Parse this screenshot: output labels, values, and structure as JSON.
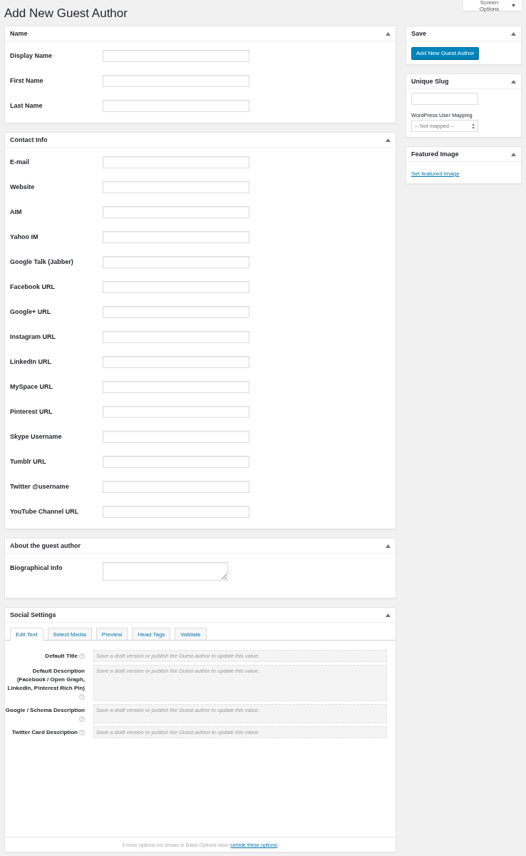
{
  "page_title": "Add New Guest Author",
  "screen_options": {
    "label": "Screen Options"
  },
  "name_box": {
    "title": "Name",
    "fields": [
      {
        "label": "Display Name"
      },
      {
        "label": "First Name"
      },
      {
        "label": "Last Name"
      }
    ]
  },
  "contact_box": {
    "title": "Contact Info",
    "fields": [
      {
        "label": "E-mail"
      },
      {
        "label": "Website"
      },
      {
        "label": "AIM"
      },
      {
        "label": "Yahoo IM"
      },
      {
        "label": "Google Talk (Jabber)"
      },
      {
        "label": "Facebook URL"
      },
      {
        "label": "Google+ URL"
      },
      {
        "label": "Instagram URL"
      },
      {
        "label": "LinkedIn URL"
      },
      {
        "label": "MySpace URL"
      },
      {
        "label": "Pinterest URL"
      },
      {
        "label": "Skype Username"
      },
      {
        "label": "Tumblr URL"
      },
      {
        "label": "Twitter @username"
      },
      {
        "label": "YouTube Channel URL"
      }
    ]
  },
  "about_box": {
    "title": "About the guest author",
    "fields": [
      {
        "label": "Biographical Info"
      }
    ]
  },
  "social_box": {
    "title": "Social Settings",
    "tabs": [
      {
        "label": "Edit Text",
        "selected": true
      },
      {
        "label": "Select Media",
        "selected": false
      },
      {
        "label": "Preview",
        "selected": false
      },
      {
        "label": "Head Tags",
        "selected": false
      },
      {
        "label": "Validate",
        "selected": false
      }
    ],
    "fields": [
      {
        "label": "Default Title",
        "placeholder": "Save a draft version or publish the Guest-author to update this value."
      },
      {
        "label": "Default Description (Facebook / Open Graph, LinkedIn, Pinterest Rich Pin)",
        "placeholder": "Save a draft version or publish the Guest-author to update this value."
      },
      {
        "label": "Google / Schema Description",
        "placeholder": "Save a draft version or publish the Guest-author to update this value."
      },
      {
        "label": "Twitter Card Description",
        "placeholder": "Save a draft version or publish the Guest-author to update this value."
      }
    ],
    "footer": {
      "text_before": "3 more options not shown in Basic Options view (",
      "link": "unhide these options",
      "text_after": ")"
    }
  },
  "save_box": {
    "title": "Save",
    "button": "Add New Guest Author"
  },
  "slug_box": {
    "title": "Unique Slug",
    "mapping_label": "WordPress User Mapping",
    "mapping_value": "-- Not mapped --"
  },
  "image_box": {
    "title": "Featured Image",
    "link": "Set featured image"
  }
}
